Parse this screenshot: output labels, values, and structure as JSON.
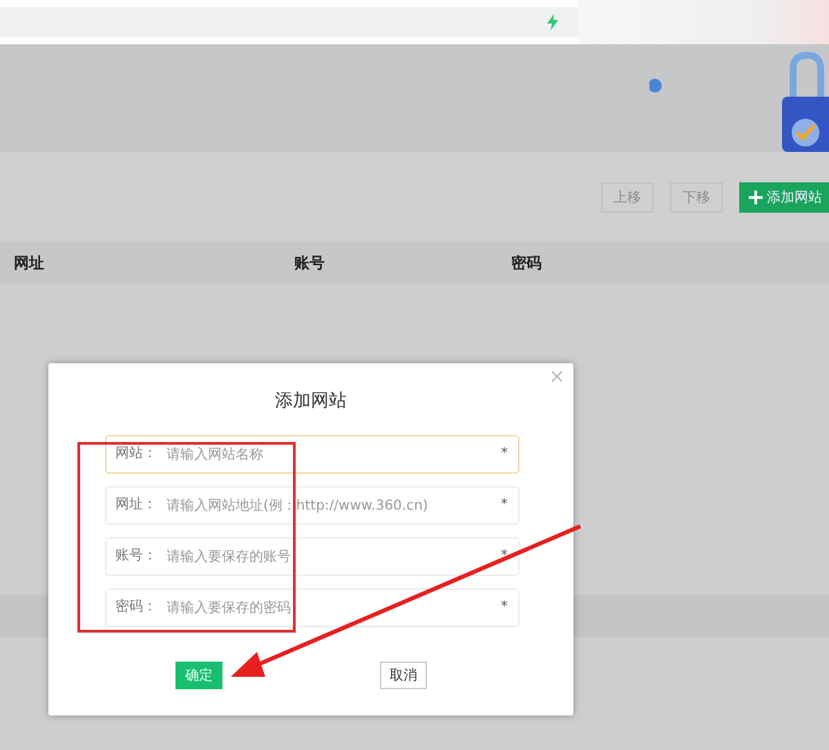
{
  "toolbar": {
    "buttons": [
      {
        "label": "上移",
        "kind": "plain",
        "disabled": true
      },
      {
        "label": "下移",
        "kind": "plain",
        "disabled": true
      },
      {
        "label": "添加网站",
        "kind": "primary",
        "disabled": false
      }
    ]
  },
  "table": {
    "columns": [
      "网址",
      "账号",
      "密码"
    ]
  },
  "dialog": {
    "title": "添加网站",
    "close": "×",
    "fields": [
      {
        "label": "网站：",
        "placeholder": "请输入网站名称",
        "required": "*",
        "focused": true
      },
      {
        "label": "网址：",
        "placeholder": "请输入网站地址(例：http://www.360.cn)",
        "required": "*",
        "focused": false
      },
      {
        "label": "账号：",
        "placeholder": "请输入要保存的账号",
        "required": "*",
        "focused": false
      },
      {
        "label": "密码：",
        "placeholder": "请输入要保存的密码",
        "required": "*",
        "focused": false
      }
    ],
    "buttons": [
      {
        "label": "确定",
        "kind": "primary"
      },
      {
        "label": "取消",
        "kind": "plain"
      }
    ]
  }
}
